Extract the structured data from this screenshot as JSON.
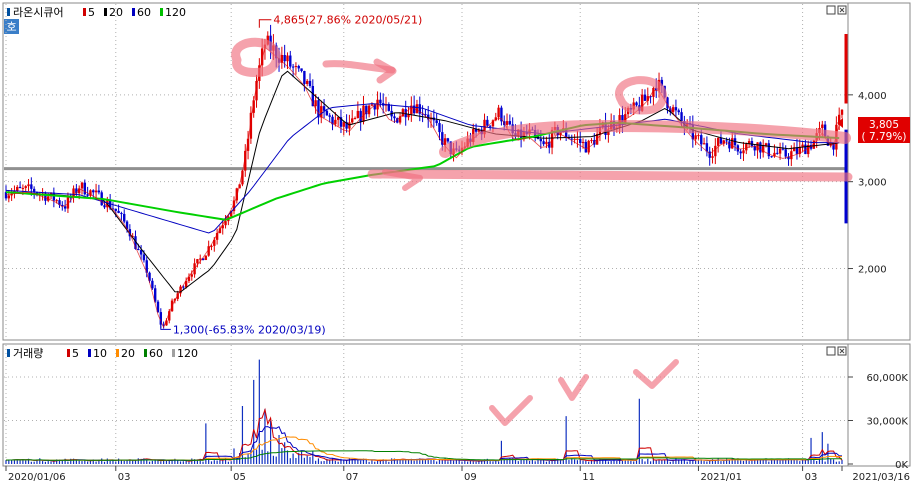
{
  "chart_data": [
    {
      "type": "candlestick",
      "title": "라온시큐어",
      "legend": [
        {
          "label": "5",
          "color": "#d00000"
        },
        {
          "label": "20",
          "color": "#000000"
        },
        {
          "label": "60",
          "color": "#0000c0"
        },
        {
          "label": "120",
          "color": "#00c000"
        }
      ],
      "ylim": [
        1200,
        5000
      ],
      "y_ticks": [
        {
          "value": 2000,
          "label": "2,000"
        },
        {
          "value": 3000,
          "label": "3,000"
        },
        {
          "value": 4000,
          "label": "4,000"
        }
      ],
      "annotations": {
        "high": {
          "value": 4865,
          "label": "4,865(27.86% 2020/05/21)"
        },
        "low": {
          "value": 1300,
          "label": "1,300(-65.83% 2020/03/19)"
        }
      },
      "current": {
        "price_label": "3,805",
        "change_label": "( 7.79%)"
      },
      "support_level": 3150,
      "price_path": [
        [
          0,
          2880
        ],
        [
          5,
          2910
        ],
        [
          10,
          2800
        ],
        [
          12,
          2720
        ],
        [
          15,
          2950
        ],
        [
          18,
          2860
        ],
        [
          22,
          2700
        ],
        [
          25,
          2470
        ],
        [
          27,
          2200
        ],
        [
          29,
          1950
        ],
        [
          31,
          1500
        ],
        [
          32,
          1300
        ],
        [
          34,
          1600
        ],
        [
          37,
          1900
        ],
        [
          41,
          2200
        ],
        [
          45,
          2600
        ],
        [
          47,
          2800
        ],
        [
          49,
          3300
        ],
        [
          51,
          4100
        ],
        [
          53,
          4600
        ],
        [
          55,
          4500
        ],
        [
          58,
          4350
        ],
        [
          61,
          4150
        ],
        [
          64,
          3800
        ],
        [
          67,
          3700
        ],
        [
          70,
          3600
        ],
        [
          73,
          3800
        ],
        [
          76,
          3950
        ],
        [
          79,
          3700
        ],
        [
          83,
          3900
        ],
        [
          86,
          3800
        ],
        [
          89,
          3500
        ],
        [
          92,
          3300
        ],
        [
          95,
          3500
        ],
        [
          98,
          3650
        ],
        [
          101,
          3800
        ],
        [
          104,
          3500
        ],
        [
          107,
          3550
        ],
        [
          110,
          3400
        ],
        [
          113,
          3600
        ],
        [
          116,
          3500
        ],
        [
          119,
          3400
        ],
        [
          122,
          3600
        ],
        [
          125,
          3700
        ],
        [
          128,
          3800
        ],
        [
          131,
          3950
        ],
        [
          133,
          4150
        ],
        [
          135,
          3950
        ],
        [
          138,
          3700
        ],
        [
          141,
          3500
        ],
        [
          144,
          3350
        ],
        [
          147,
          3500
        ],
        [
          150,
          3400
        ],
        [
          153,
          3450
        ],
        [
          156,
          3350
        ],
        [
          159,
          3300
        ],
        [
          162,
          3350
        ],
        [
          165,
          3450
        ],
        [
          167,
          3600
        ],
        [
          169,
          3400
        ],
        [
          171,
          3805
        ]
      ],
      "ma_paths": {
        "ma20": [
          [
            0,
            2880
          ],
          [
            10,
            2850
          ],
          [
            20,
            2800
          ],
          [
            28,
            2200
          ],
          [
            35,
            1700
          ],
          [
            42,
            2000
          ],
          [
            47,
            2400
          ],
          [
            52,
            3600
          ],
          [
            57,
            4300
          ],
          [
            62,
            4050
          ],
          [
            70,
            3650
          ],
          [
            80,
            3800
          ],
          [
            90,
            3700
          ],
          [
            100,
            3550
          ],
          [
            110,
            3500
          ],
          [
            120,
            3520
          ],
          [
            130,
            3700
          ],
          [
            135,
            3850
          ],
          [
            140,
            3600
          ],
          [
            150,
            3450
          ],
          [
            160,
            3380
          ],
          [
            171,
            3450
          ]
        ],
        "ma60": [
          [
            0,
            2900
          ],
          [
            15,
            2850
          ],
          [
            30,
            2600
          ],
          [
            42,
            2400
          ],
          [
            50,
            2900
          ],
          [
            58,
            3500
          ],
          [
            66,
            3850
          ],
          [
            75,
            3900
          ],
          [
            85,
            3850
          ],
          [
            95,
            3650
          ],
          [
            110,
            3550
          ],
          [
            125,
            3650
          ],
          [
            135,
            3720
          ],
          [
            150,
            3550
          ],
          [
            165,
            3450
          ],
          [
            171,
            3450
          ]
        ],
        "ma120": [
          [
            0,
            2880
          ],
          [
            20,
            2800
          ],
          [
            35,
            2650
          ],
          [
            45,
            2560
          ],
          [
            55,
            2800
          ],
          [
            65,
            2980
          ],
          [
            75,
            3080
          ],
          [
            88,
            3180
          ],
          [
            95,
            3400
          ],
          [
            108,
            3520
          ],
          [
            118,
            3650
          ],
          [
            125,
            3680
          ],
          [
            140,
            3620
          ],
          [
            155,
            3550
          ],
          [
            171,
            3500
          ]
        ]
      },
      "x_ticks": [
        {
          "idx": 0,
          "label": "2020/01/06"
        },
        {
          "idx": 39,
          "label": "03"
        },
        {
          "idx": 80,
          "label": "05"
        },
        {
          "idx": 120,
          "label": "07"
        },
        {
          "idx": 162,
          "label": "09"
        },
        {
          "idx": 204,
          "label": "11"
        },
        {
          "idx": 246,
          "label": "2021/01"
        },
        {
          "idx": 283,
          "label": "03"
        },
        {
          "idx": 297,
          "label": "2021/03/16"
        }
      ],
      "n_days": 298
    },
    {
      "type": "bar",
      "title": "거래량",
      "legend": [
        {
          "label": "5",
          "color": "#d00000"
        },
        {
          "label": "10",
          "color": "#0000c0"
        },
        {
          "label": "20",
          "color": "#ff8c00"
        },
        {
          "label": "60",
          "color": "#008000"
        },
        {
          "label": "120",
          "color": "#a0a0a0"
        }
      ],
      "ylim": [
        0,
        80000
      ],
      "y_ticks": [
        {
          "value": 0,
          "label": "0K"
        },
        {
          "value": 30000,
          "label": "30,000K"
        },
        {
          "value": 60000,
          "label": "60,000K"
        }
      ],
      "spikes": [
        {
          "idx": 71,
          "value": 28000
        },
        {
          "idx": 84,
          "value": 40000
        },
        {
          "idx": 88,
          "value": 58000
        },
        {
          "idx": 90,
          "value": 72000
        },
        {
          "idx": 92,
          "value": 38000
        },
        {
          "idx": 94,
          "value": 30000
        },
        {
          "idx": 97,
          "value": 20000
        },
        {
          "idx": 99,
          "value": 15000
        },
        {
          "idx": 176,
          "value": 16000
        },
        {
          "idx": 199,
          "value": 33000
        },
        {
          "idx": 225,
          "value": 45000
        },
        {
          "idx": 286,
          "value": 18000
        },
        {
          "idx": 290,
          "value": 22000
        },
        {
          "idx": 292,
          "value": 14000
        }
      ]
    }
  ]
}
